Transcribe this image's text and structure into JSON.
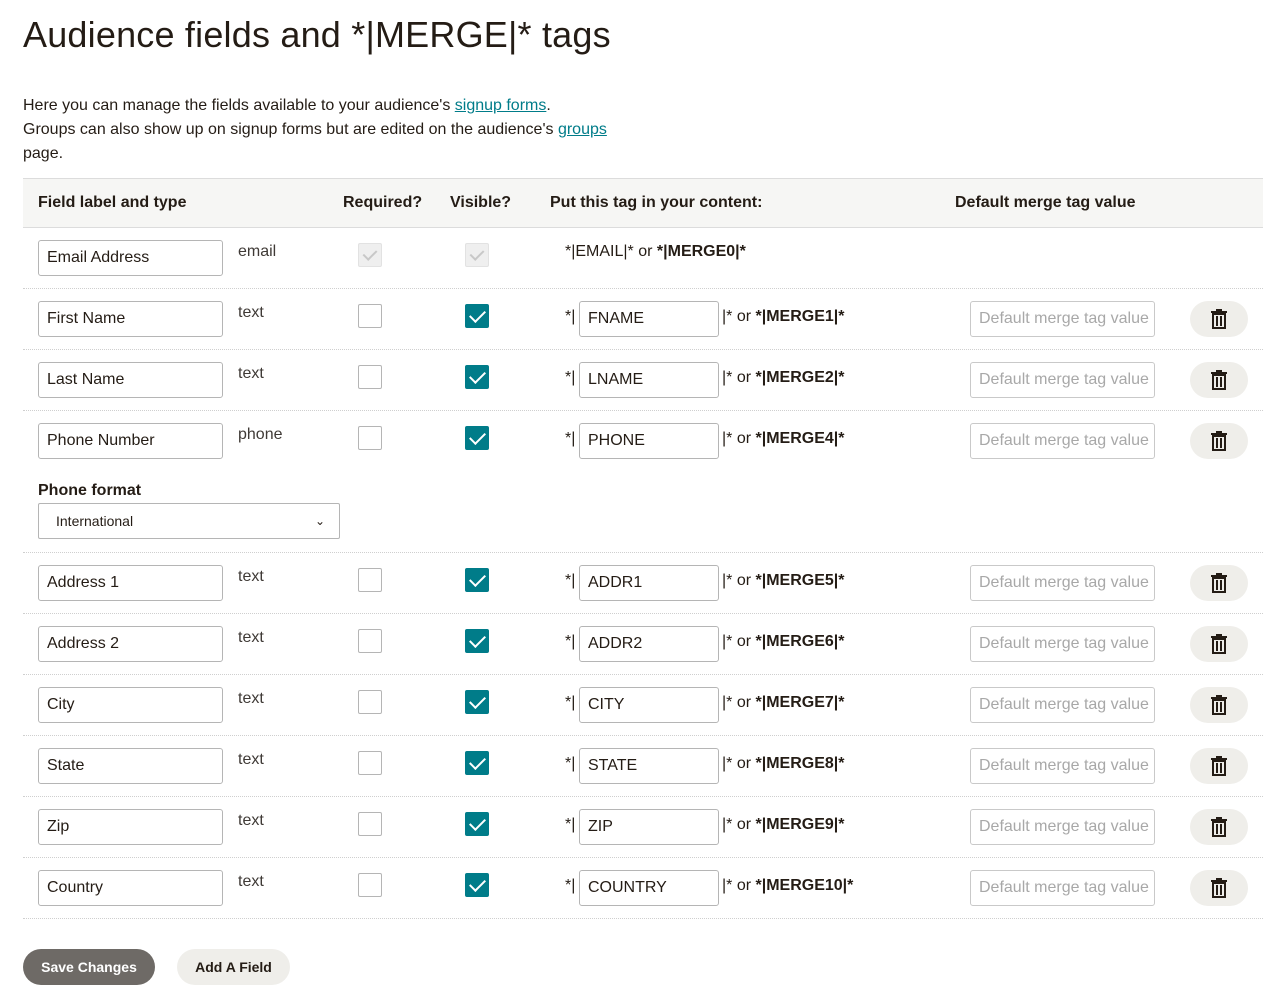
{
  "page": {
    "title": "Audience fields and *|MERGE|* tags",
    "intro": {
      "line1_before": "Here you can manage the fields available to your audience's ",
      "line1_link": "signup forms",
      "line1_after": ".",
      "line2_before": "Groups can also show up on signup forms but are edited on the audience's ",
      "line2_link": "groups",
      "line3": "page."
    }
  },
  "table": {
    "headers": {
      "label": "Field label and type",
      "required": "Required?",
      "visible": "Visible?",
      "tag": "Put this tag in your content:",
      "default": "Default merge tag value"
    },
    "email_row": {
      "label": "Email Address",
      "type": "email",
      "tag_text": "*|EMAIL|* or ",
      "tag_bold": "*|MERGE0|*"
    },
    "rows": [
      {
        "label": "First Name",
        "type": "text",
        "tag": "FNAME",
        "merge": "*|MERGE1|*"
      },
      {
        "label": "Last Name",
        "type": "text",
        "tag": "LNAME",
        "merge": "*|MERGE2|*"
      },
      {
        "label": "Phone Number",
        "type": "phone",
        "tag": "PHONE",
        "merge": "*|MERGE4|*"
      },
      {
        "label": "Address 1",
        "type": "text",
        "tag": "ADDR1",
        "merge": "*|MERGE5|*"
      },
      {
        "label": "Address 2",
        "type": "text",
        "tag": "ADDR2",
        "merge": "*|MERGE6|*"
      },
      {
        "label": "City",
        "type": "text",
        "tag": "CITY",
        "merge": "*|MERGE7|*"
      },
      {
        "label": "State",
        "type": "text",
        "tag": "STATE",
        "merge": "*|MERGE8|*"
      },
      {
        "label": "Zip",
        "type": "text",
        "tag": "ZIP",
        "merge": "*|MERGE9|*"
      },
      {
        "label": "Country",
        "type": "text",
        "tag": "COUNTRY",
        "merge": "*|MERGE10|*"
      }
    ],
    "tag_prefix": "*|",
    "tag_suffix_plain": "|* or ",
    "default_placeholder": "Default merge tag value",
    "phone_format": {
      "label": "Phone format",
      "selected": "International"
    }
  },
  "actions": {
    "save": "Save Changes",
    "add": "Add A Field"
  },
  "icons": {
    "delete": "trash-icon",
    "checkbox_checked": "checkmark-icon",
    "select": "chevron-down-icon"
  },
  "colors": {
    "accent": "#007c89",
    "save_button": "#6e6a66"
  }
}
